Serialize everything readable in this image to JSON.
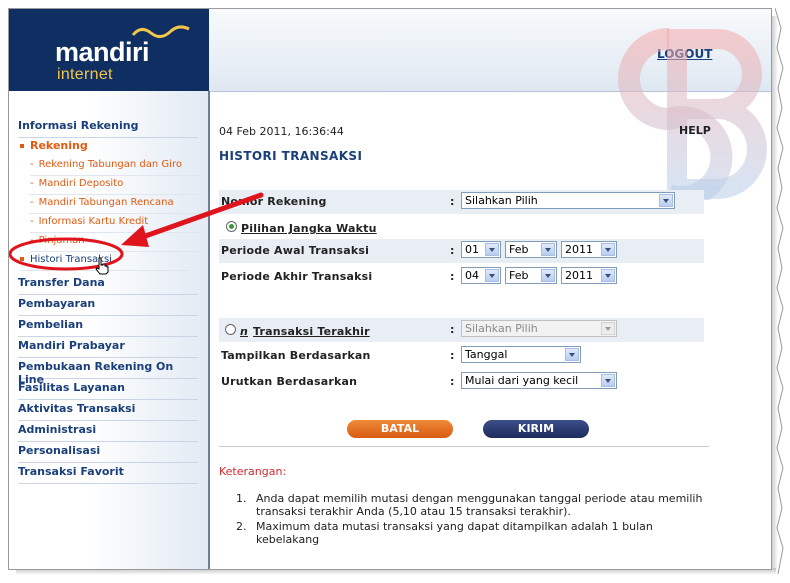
{
  "brand": {
    "name": "mandiri",
    "sub": "internet"
  },
  "header": {
    "logout": "LOGOUT"
  },
  "sidebar": {
    "section_title": "Informasi Rekening",
    "group_label": "Rekening",
    "items": [
      "Rekening Tabungan dan Giro",
      "Mandiri Deposito",
      "Mandiri Tabungan Rencana",
      "Informasi Kartu Kredit",
      "Pinjaman"
    ],
    "selected_item": "Histori Transaksi",
    "menu": [
      "Transfer Dana",
      "Pembayaran",
      "Pembelian",
      "Mandiri Prabayar",
      "Pembukaan Rekening On Line",
      "Fasilitas Layanan",
      "Aktivitas Transaksi",
      "Administrasi",
      "Personalisasi",
      "Transaksi Favorit"
    ]
  },
  "main": {
    "datetime": "04 Feb 2011, 16:36:44",
    "help": "HELP",
    "title": "HISTORI TRANSAKSI",
    "form": {
      "account_label": "Nomor Rekening",
      "account_value": "Silahkan Pilih",
      "period_option_label": "Pilihan Jangka Waktu",
      "start_label": "Periode Awal Transaksi",
      "start_day": "01",
      "start_month": "Feb",
      "start_year": "2011",
      "end_label": "Periode Akhir Transaksi",
      "end_day": "04",
      "end_month": "Feb",
      "end_year": "2011",
      "n_prefix": "n",
      "n_option_label": "Transaksi Terakhir",
      "n_value": "Silahkan Pilih",
      "show_by_label": "Tampilkan Berdasarkan",
      "show_by_value": "Tanggal",
      "sort_label": "Urutkan Berdasarkan",
      "sort_value": "Mulai dari yang kecil",
      "colon": ":"
    },
    "buttons": {
      "cancel": "BATAL",
      "submit": "KIRIM"
    },
    "notes_title": "Keterangan:",
    "notes": [
      {
        "num": "1.",
        "text": "Anda dapat memilih mutasi dengan menggunakan tanggal periode atau memilih transaksi terakhir Anda (5,10 atau 15 transaksi terakhir)."
      },
      {
        "num": "2.",
        "text": "Maximum data mutasi transaksi yang dapat ditampilkan adalah 1 bulan kebelakang"
      }
    ]
  },
  "colors": {
    "navy": "#0f2f63",
    "orange": "#e05a12",
    "link_blue": "#1a3f7a",
    "annotation_red": "#e0141c"
  }
}
